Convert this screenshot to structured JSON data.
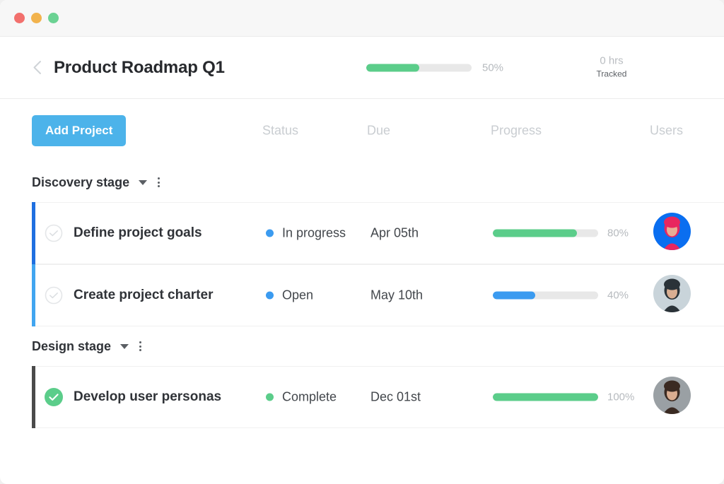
{
  "window": {
    "lights": [
      {
        "name": "close",
        "color": "#f2706d"
      },
      {
        "name": "minimize",
        "color": "#f2b34d"
      },
      {
        "name": "maximize",
        "color": "#6bd293"
      }
    ]
  },
  "header": {
    "back_icon": "chevron-left-icon",
    "title": "Product Roadmap Q1",
    "progress_percent": 50,
    "progress_label": "50%",
    "progress_color": "#5bcd8a",
    "tracked_hours": "0 hrs",
    "tracked_label": "Tracked"
  },
  "toolbar": {
    "add_project_label": "Add Project",
    "add_project_color": "#4cb3ea",
    "columns": [
      {
        "key": "status",
        "label": "Status"
      },
      {
        "key": "due",
        "label": "Due"
      },
      {
        "key": "progress",
        "label": "Progress"
      },
      {
        "key": "users",
        "label": "Users"
      }
    ]
  },
  "stages": [
    {
      "name": "Discovery stage",
      "caret_icon": "caret-down-icon",
      "menu_icon": "kebab-menu-icon",
      "tasks": [
        {
          "accent_color": "#1f6fe0",
          "done": false,
          "check_icon": "circle-check-outline-icon",
          "name": "Define project goals",
          "status": "In progress",
          "status_color": "#3b9bf0",
          "due": "Apr 05th",
          "progress_percent": 80,
          "progress_label": "80%",
          "progress_color": "#5bcd8a",
          "avatar_name": "avatar-define-project-goals",
          "avatar_bg": "#0a6ef0",
          "avatar_accent": "#e8265f"
        },
        {
          "accent_color": "#41a5f0",
          "done": false,
          "check_icon": "circle-check-outline-icon",
          "name": "Create project charter",
          "status": "Open",
          "status_color": "#3b9bf0",
          "due": "May 10th",
          "progress_percent": 40,
          "progress_label": "40%",
          "progress_color": "#3b9bf0",
          "avatar_name": "avatar-create-project-charter",
          "avatar_bg": "#c9d4da",
          "avatar_accent": "#2a3238"
        }
      ]
    },
    {
      "name": "Design stage",
      "caret_icon": "caret-down-icon",
      "menu_icon": "kebab-menu-icon",
      "tasks": [
        {
          "accent_color": "#4a4a4a",
          "done": true,
          "check_icon": "circle-check-filled-icon",
          "name": "Develop user personas",
          "status": "Complete",
          "status_color": "#5bcd8a",
          "due": "Dec 01st",
          "progress_percent": 100,
          "progress_label": "100%",
          "progress_color": "#5bcd8a",
          "avatar_name": "avatar-develop-user-personas",
          "avatar_bg": "#9aa0a4",
          "avatar_accent": "#3a2a22"
        }
      ]
    }
  ]
}
